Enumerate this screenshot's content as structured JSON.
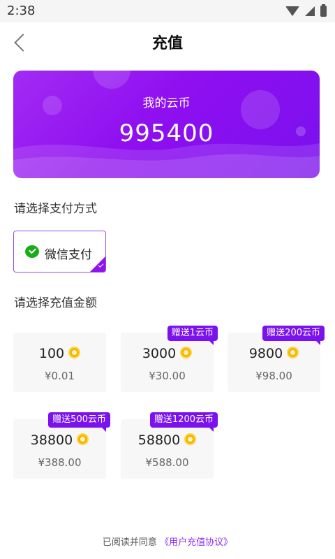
{
  "status_bar": {
    "time": "2:38"
  },
  "header": {
    "title": "充值"
  },
  "balance": {
    "label": "我的云币",
    "value": "995400"
  },
  "payment": {
    "section_title": "请选择支付方式",
    "method_label": "微信支付"
  },
  "amounts": {
    "section_title": "请选择充值金额",
    "options": [
      {
        "coins": "100",
        "price": "¥0.01",
        "bonus": ""
      },
      {
        "coins": "3000",
        "price": "¥30.00",
        "bonus": "赠送1云币"
      },
      {
        "coins": "9800",
        "price": "¥98.00",
        "bonus": "赠送200云币"
      },
      {
        "coins": "38800",
        "price": "¥388.00",
        "bonus": "赠送500云币"
      },
      {
        "coins": "58800",
        "price": "¥588.00",
        "bonus": "赠送1200云币"
      }
    ]
  },
  "footer": {
    "agreement_prefix": "已阅读并同意",
    "agreement_link": "《用户充值协议》"
  },
  "colors": {
    "accent": "#8e14ee",
    "wechat": "#1aad19",
    "coin": "#f7b500"
  }
}
